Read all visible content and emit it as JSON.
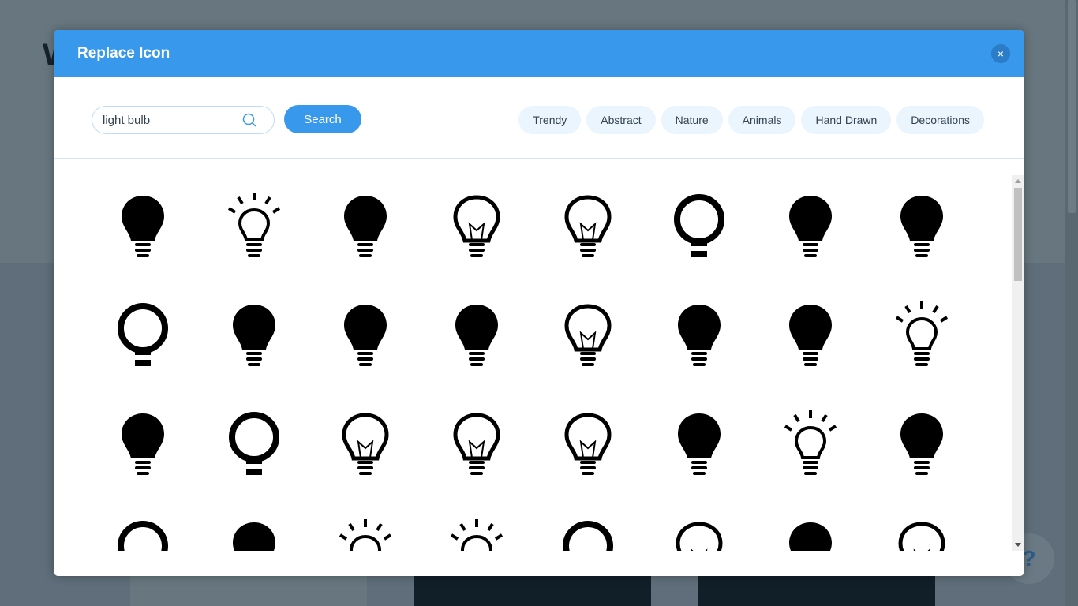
{
  "background": {
    "letter": "W",
    "help_label": "?"
  },
  "modal": {
    "title": "Replace Icon",
    "close_label": "×",
    "search": {
      "value": "light bulb",
      "button_label": "Search"
    },
    "categories": [
      "Trendy",
      "Abstract",
      "Nature",
      "Animals",
      "Hand Drawn",
      "Decorations"
    ],
    "colors": {
      "accent": "#3899ec",
      "chip_bg": "#eaf5fe"
    },
    "icons": [
      {
        "name": "bulb-filled",
        "style": "filled"
      },
      {
        "name": "bulb-rays-filament",
        "style": "rays"
      },
      {
        "name": "bulb-small-filled",
        "style": "filled"
      },
      {
        "name": "bulb-outline-filament",
        "style": "outline"
      },
      {
        "name": "bulb-outline-tilted",
        "style": "outline"
      },
      {
        "name": "bulb-face",
        "style": "ring"
      },
      {
        "name": "bulb-filled",
        "style": "filled"
      },
      {
        "name": "bulb-shine",
        "style": "filled"
      },
      {
        "name": "bulb-ring",
        "style": "ring"
      },
      {
        "name": "bulb-filled-tall",
        "style": "filled"
      },
      {
        "name": "bulb-spiral",
        "style": "filled"
      },
      {
        "name": "bulb-filled-bands",
        "style": "filled"
      },
      {
        "name": "bulb-outline-filament",
        "style": "outline"
      },
      {
        "name": "bulb-small-filled",
        "style": "filled"
      },
      {
        "name": "bulb-filament-filled",
        "style": "filled"
      },
      {
        "name": "bulb-rays-small",
        "style": "rays"
      },
      {
        "name": "bulb-filament-filled",
        "style": "filled"
      },
      {
        "name": "bulb-ring-small",
        "style": "ring"
      },
      {
        "name": "bulb-outline-round",
        "style": "outline"
      },
      {
        "name": "bulb-outline-filament",
        "style": "outline"
      },
      {
        "name": "bulb-outline-coil",
        "style": "outline"
      },
      {
        "name": "bulb-filled",
        "style": "filled"
      },
      {
        "name": "bulb-rays-outline",
        "style": "rays"
      },
      {
        "name": "bulb-filled",
        "style": "filled"
      },
      {
        "name": "bulb-ring",
        "style": "ring"
      },
      {
        "name": "bulb-filled",
        "style": "filled"
      },
      {
        "name": "sun-rays",
        "style": "rays"
      },
      {
        "name": "sun-rays",
        "style": "rays"
      },
      {
        "name": "bulb-ring",
        "style": "ring"
      },
      {
        "name": "bulb-outline",
        "style": "outline"
      },
      {
        "name": "bulb-filled",
        "style": "filled"
      },
      {
        "name": "bulb-outline-small",
        "style": "outline"
      }
    ]
  }
}
